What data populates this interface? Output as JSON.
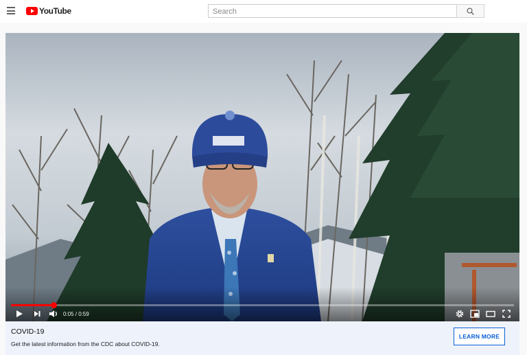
{
  "header": {
    "logo_text": "YouTube",
    "search_placeholder": "Search",
    "icons": [
      "menu-icon",
      "youtube-logo-icon",
      "search-icon"
    ]
  },
  "player": {
    "current_time": "0:05",
    "duration": "0:59",
    "time_display": "0:05 / 0:59",
    "progress": 0.085,
    "colors": {
      "progress": "#ff0000"
    },
    "controls": [
      "play-icon",
      "next-icon",
      "volume-icon",
      "settings-icon",
      "miniplayer-icon",
      "theater-icon",
      "fullscreen-icon"
    ]
  },
  "info_banner": {
    "title": "COVID-19",
    "text": "Get the latest information from the CDC about COVID-19.",
    "button_label": "LEARN MORE",
    "colors": {
      "background": "#eef2fb",
      "button": "#065fd4"
    }
  }
}
